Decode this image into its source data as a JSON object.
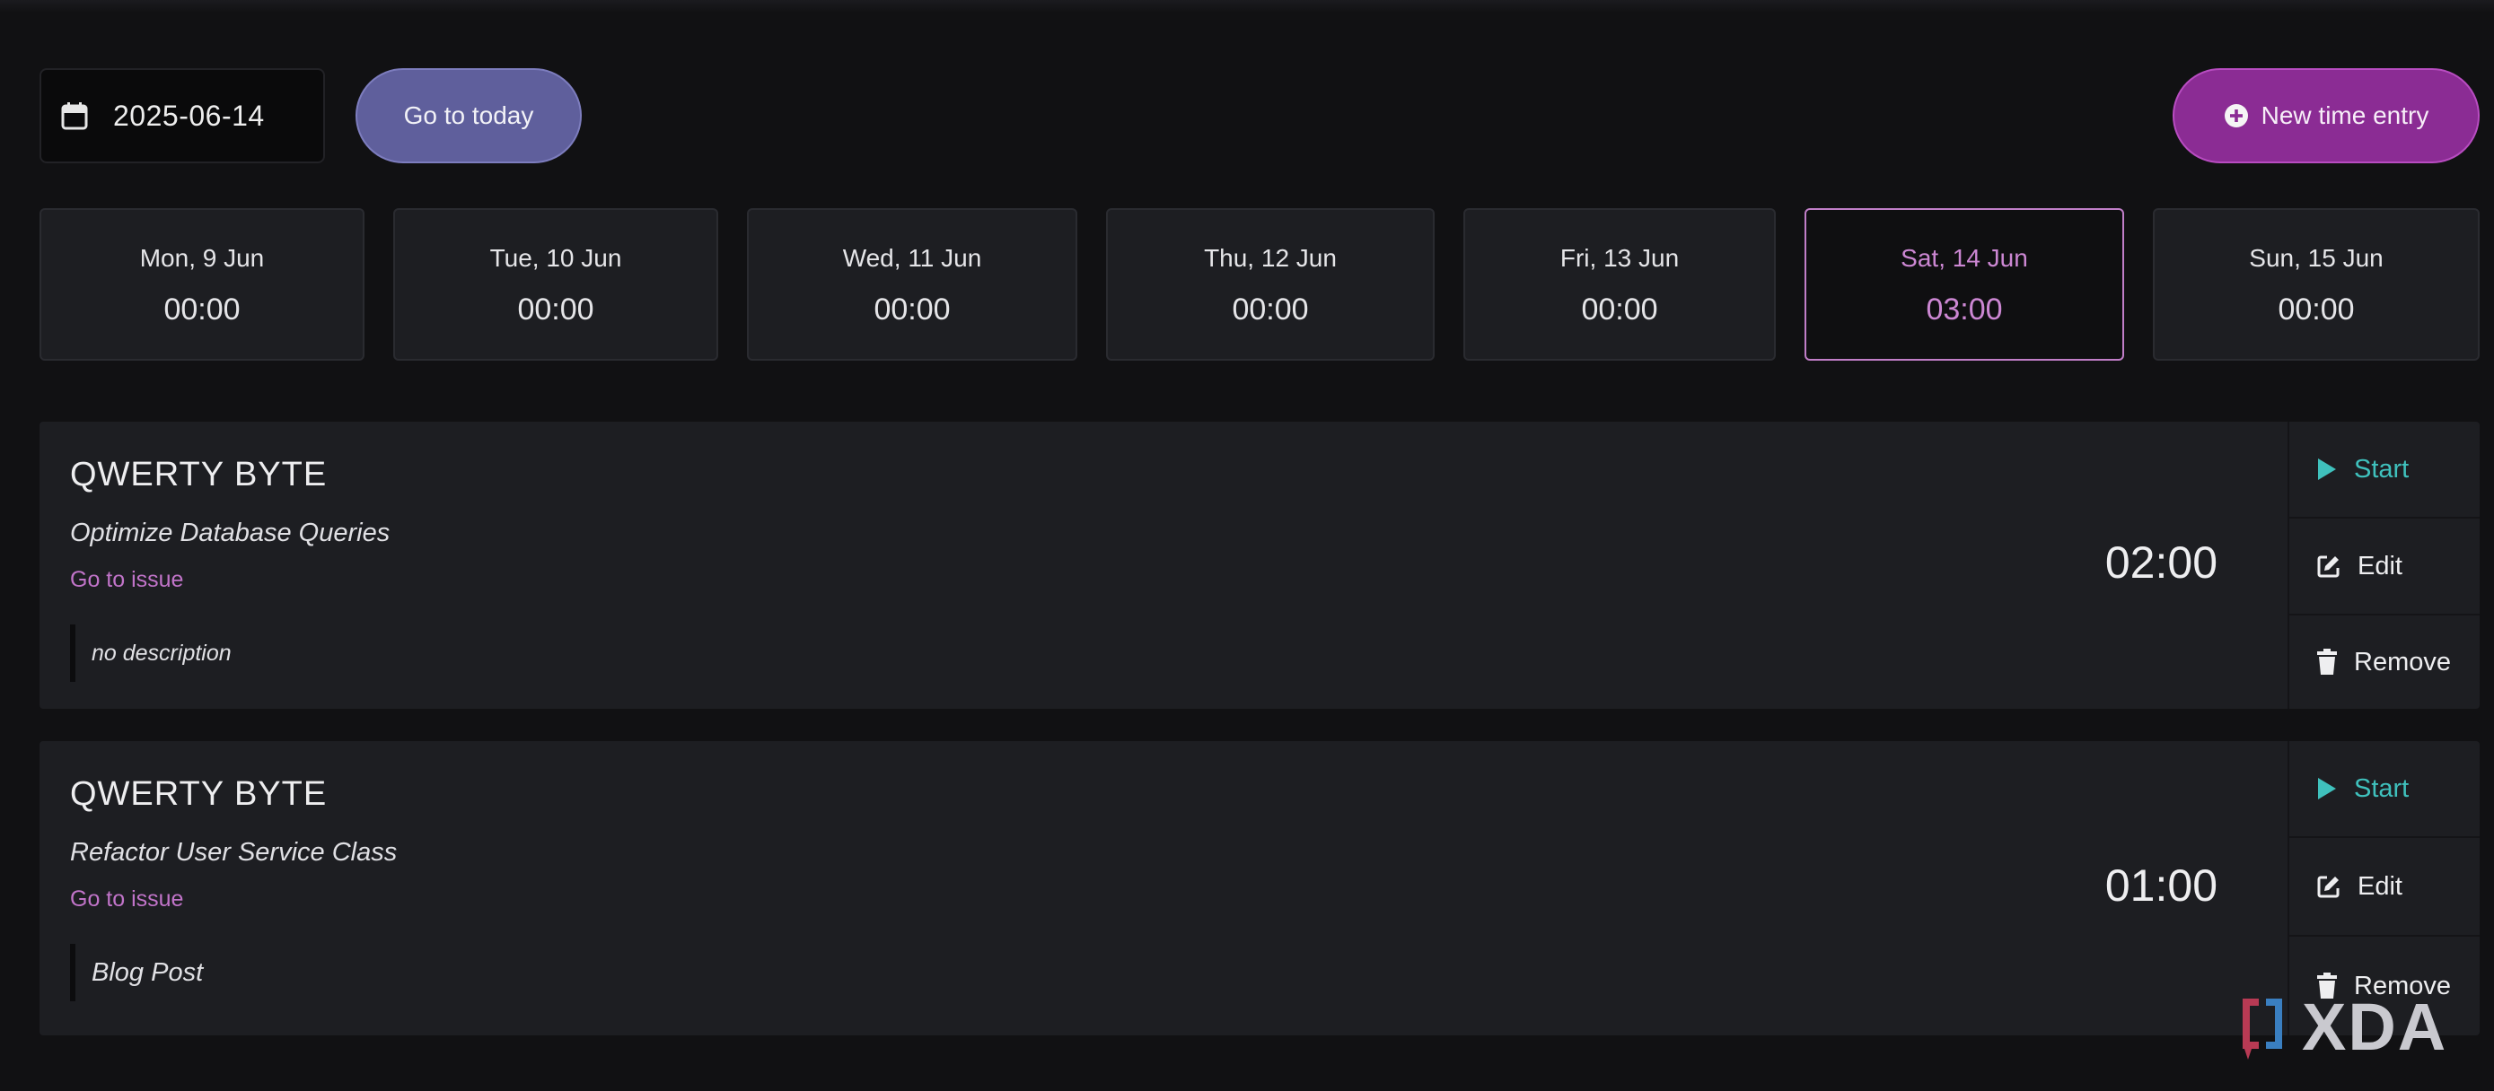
{
  "toolbar": {
    "date_value": "2025-06-14",
    "today_label": "Go to today",
    "new_entry_label": "New time entry"
  },
  "week": [
    {
      "label": "Mon, 9 Jun",
      "total": "00:00",
      "selected": false
    },
    {
      "label": "Tue, 10 Jun",
      "total": "00:00",
      "selected": false
    },
    {
      "label": "Wed, 11 Jun",
      "total": "00:00",
      "selected": false
    },
    {
      "label": "Thu, 12 Jun",
      "total": "00:00",
      "selected": false
    },
    {
      "label": "Fri, 13 Jun",
      "total": "00:00",
      "selected": false
    },
    {
      "label": "Sat, 14 Jun",
      "total": "03:00",
      "selected": true
    },
    {
      "label": "Sun, 15 Jun",
      "total": "00:00",
      "selected": false
    }
  ],
  "entries": [
    {
      "project": "QWERTY BYTE",
      "task": "Optimize Database Queries",
      "issue_link": "Go to issue",
      "description": "no description",
      "duration": "02:00",
      "actions": {
        "start": "Start",
        "edit": "Edit",
        "remove": "Remove"
      }
    },
    {
      "project": "QWERTY BYTE",
      "task": "Refactor User Service Class",
      "issue_link": "Go to issue",
      "description": "Blog Post",
      "duration": "01:00",
      "actions": {
        "start": "Start",
        "edit": "Edit",
        "remove": "Remove"
      }
    }
  ],
  "watermark": {
    "text": "XDA"
  },
  "colors": {
    "background": "#111113",
    "card": "#1d1e22",
    "accent_purple": "#c17ec8",
    "today_button": "#5f5f9c",
    "new_entry_button": "#8b2c94",
    "start_teal": "#3fc1bd"
  }
}
